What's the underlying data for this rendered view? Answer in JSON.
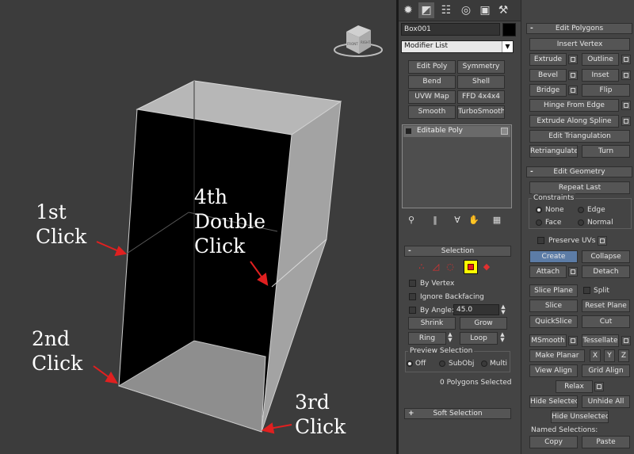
{
  "annotations": {
    "first": "1st\nClick",
    "second": "2nd\nClick",
    "third": "3rd\nClick",
    "fourth": "4th\nDouble\nClick"
  },
  "viewcube": {
    "face_front": "FRONT",
    "face_right": "RIGHT"
  },
  "command_panel": {
    "tabs": [
      "create-icon",
      "modify-icon",
      "hierarchy-icon",
      "motion-icon",
      "utilities-icon"
    ],
    "object_name": "Box001",
    "object_color": "#000000",
    "modifier_list": "Modifier List",
    "modifier_buttons": [
      "Edit Poly",
      "Symmetry",
      "Bend",
      "Shell",
      "UVW Map",
      "FFD 4x4x4",
      "Smooth",
      "TurboSmooth"
    ],
    "stack_item": "Editable Poly",
    "stack_tools": [
      "pin-stack-icon",
      "show-end-result-icon",
      "make-unique-icon",
      "remove-modifier-icon",
      "configure-sets-icon"
    ],
    "selection": {
      "title": "Selection",
      "sign": "-",
      "levels": [
        "vertex-icon",
        "edge-icon",
        "border-icon",
        "polygon-icon",
        "element-icon"
      ],
      "active_level": "polygon-icon",
      "active_color": "#ffff00",
      "by_vertex": "By Vertex",
      "ignore_backfacing": "Ignore Backfacing",
      "by_angle": "By Angle:",
      "angle_value": "45.0",
      "shrink": "Shrink",
      "grow": "Grow",
      "ring": "Ring",
      "loop": "Loop",
      "preview_title": "Preview Selection",
      "preview_options": [
        "Off",
        "SubObj",
        "Multi"
      ],
      "preview_selected": "Off",
      "status": "0 Polygons Selected"
    },
    "soft_selection": {
      "title": "Soft Selection",
      "sign": "+"
    }
  },
  "edit_polygons": {
    "title": "Edit Polygons",
    "sign": "-",
    "insert_vertex": "Insert Vertex",
    "extrude": "Extrude",
    "outline": "Outline",
    "bevel": "Bevel",
    "inset": "Inset",
    "bridge": "Bridge",
    "flip": "Flip",
    "hinge": "Hinge From Edge",
    "extrude_spline": "Extrude Along Spline",
    "edit_tri": "Edit Triangulation",
    "retriangulate": "Retriangulate",
    "turn": "Turn"
  },
  "edit_geometry": {
    "title": "Edit Geometry",
    "sign": "-",
    "repeat_last": "Repeat Last",
    "constraints": "Constraints",
    "constraint_options": [
      "None",
      "Edge",
      "Face",
      "Normal"
    ],
    "constraint_selected": "None",
    "preserve_uvs": "Preserve UVs",
    "create": "Create",
    "collapse": "Collapse",
    "attach": "Attach",
    "detach": "Detach",
    "slice_plane": "Slice Plane",
    "split": "Split",
    "slice": "Slice",
    "reset_plane": "Reset Plane",
    "quickslice": "QuickSlice",
    "cut": "Cut",
    "msmooth": "MSmooth",
    "tessellate": "Tessellate",
    "make_planar": "Make Planar",
    "x": "X",
    "y": "Y",
    "z": "Z",
    "view_align": "View Align",
    "grid_align": "Grid Align",
    "relax": "Relax",
    "hide_selected": "Hide Selected",
    "unhide_all": "Unhide All",
    "hide_unselected": "Hide Unselected",
    "named_selections": "Named Selections:",
    "copy": "Copy",
    "paste": "Paste"
  }
}
